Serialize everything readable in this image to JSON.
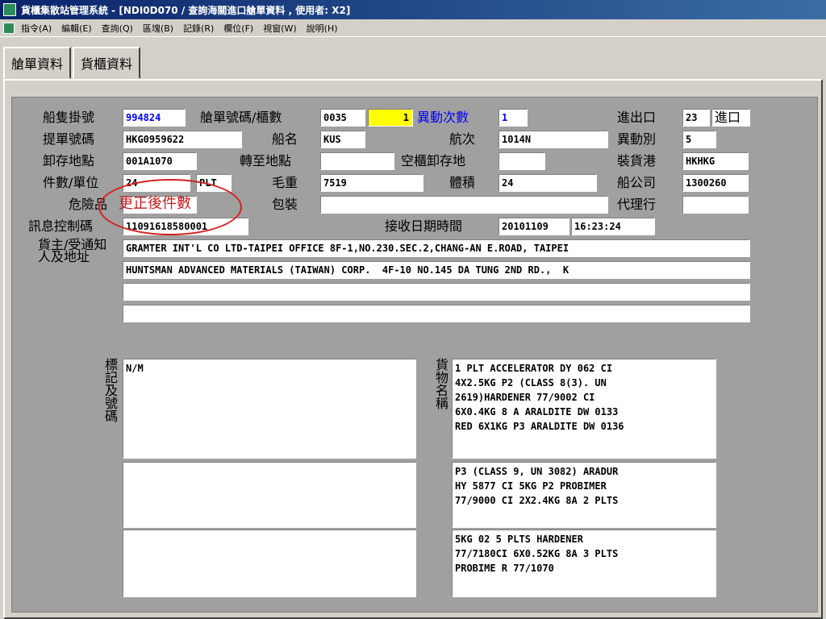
{
  "window": {
    "title": "貨櫃集散站管理系統 - [NDI0D070 / 查詢海關進口艙單資料 , 使用者: X2]"
  },
  "menu": [
    "指令(A)",
    "編輯(E)",
    "查詢(Q)",
    "區塊(B)",
    "記錄(R)",
    "欄位(F)",
    "視窗(W)",
    "說明(H)"
  ],
  "tabs": [
    "艙單資料",
    "貨櫃資料"
  ],
  "labels": {
    "vessel_call": "船隻掛號",
    "manifest_no": "艙單號碼/櫃數",
    "change_count": "異動次數",
    "in_out": "進出口",
    "bl_no": "提單號碼",
    "ship_name": "船名",
    "voyage": "航次",
    "change_type": "異動別",
    "unload_loc": "卸存地點",
    "transfer_loc": "轉至地點",
    "empty_unload": "空櫃卸存地",
    "loading_port": "裝貨港",
    "pieces_unit": "件數/單位",
    "gross_weight": "毛重",
    "volume": "體積",
    "shipping_co": "船公司",
    "dangerous": "危險品",
    "annotation": "更正後件數",
    "packaging": "包裝",
    "agent": "代理行",
    "msg_control": "訊息控制碼",
    "receive_time": "接收日期時間",
    "shipper_consignee": "貨主/受通知人及地址",
    "marks": "標記及號碼",
    "goods_name": "貨物名稱"
  },
  "values": {
    "vessel_call": "994824",
    "manifest_no": "0035",
    "container_count": "1",
    "change_count": "1",
    "in_out_code": "23",
    "in_out_text": "進口",
    "bl_no": "HKG0959622",
    "ship_name": "KUS",
    "voyage": "1014N",
    "change_type": "5",
    "unload_loc": "001A1070",
    "transfer_loc": "",
    "empty_unload": "",
    "loading_port": "HKHKG",
    "pieces": "24",
    "unit": "PLT",
    "gross_weight": "7519",
    "volume": "24",
    "shipping_co": "1300260",
    "dangerous": "",
    "packaging": "",
    "agent": "",
    "msg_control": "11091618580001",
    "receive_date": "20101109",
    "receive_clock": "16:23:24",
    "address_lines": [
      "GRAMTER INT'L CO LTD-TAIPEI OFFICE 8F-1,NO.230.SEC.2,CHANG-AN E.ROAD, TAIPEI",
      "HUNTSMAN ADVANCED MATERIALS (TAIWAN) CORP.  4F-10 NO.145 DA TUNG 2ND RD.,  K",
      "",
      ""
    ],
    "marks_boxes": [
      "N/M",
      "",
      ""
    ],
    "goods_boxes": [
      "1 PLT ACCELERATOR DY 062 CI\n4X2.5KG P2 (CLASS 8(3). UN\n2619)HARDENER 77/9002 CI\n6X0.4KG 8 A ARALDITE DW 0133\nRED 6X1KG P3 ARALDITE DW 0136",
      "P3 (CLASS 9, UN 3082) ARADUR\nHY 5877 CI 5KG P2 PROBIMER\n77/9000 CI 2X2.4KG 8A 2 PLTS",
      "5KG 02 5 PLTS HARDENER\n77/7180CI 6X0.52KG 8A 3 PLTS\nPROBIME R 77/1070"
    ]
  },
  "colors": {
    "title_bar": "#0a246a",
    "form_bg": "#a0a0a0",
    "highlight_field": "#ffff00",
    "accent_blue": "#0000ff",
    "annotation_red": "#c81e1e"
  },
  "icons": {
    "app": "app-icon"
  }
}
